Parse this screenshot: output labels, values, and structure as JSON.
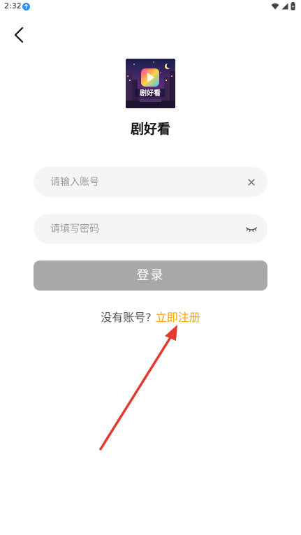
{
  "status_bar": {
    "time": "2:32"
  },
  "app": {
    "name": "剧好看",
    "logo_text": "剧好看"
  },
  "form": {
    "account_placeholder": "请输入账号",
    "password_placeholder": "请填写密码",
    "login_label": "登录"
  },
  "register": {
    "prompt": "没有账号?",
    "link_label": "立即注册"
  },
  "colors": {
    "accent": "#f4a300",
    "button_disabled": "#a8a8a8",
    "field_bg": "#f5f5f6",
    "annotation_arrow": "#e23b2e"
  },
  "icons": {
    "back": "back-chevron-icon",
    "clear": "clear-icon",
    "password_toggle": "eye-closed-icon"
  }
}
